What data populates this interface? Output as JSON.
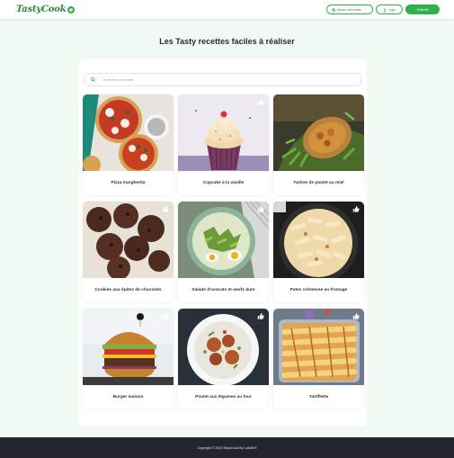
{
  "header": {
    "logo_text": "TastyCook",
    "add_recipe_label": "Ajouter une recette",
    "login_label": "Login",
    "register_label": "S'inscrire"
  },
  "page": {
    "title": "Les Tasty recettes faciles à réaliser"
  },
  "search": {
    "placeholder": "Je cherche une recette..."
  },
  "recipes": [
    {
      "title": "Pizza margherita"
    },
    {
      "title": "Cupcake à la vanille"
    },
    {
      "title": "Tartine de poulet au miel"
    },
    {
      "title": "Cookies aux épites de chocolats"
    },
    {
      "title": "Salade d'avocats et oeufs dure"
    },
    {
      "title": "Pates crèmeuse au fromage"
    },
    {
      "title": "Burger maison"
    },
    {
      "title": "Poulet aux légumes au four"
    },
    {
      "title": "Tartiflette"
    }
  ],
  "footer": {
    "text": "Copyright © 2023 TastyCook By LuisMLR"
  },
  "colors": {
    "brand_green": "#2fb24c",
    "page_bg": "#f1fbf3",
    "footer_bg": "#23252e"
  }
}
